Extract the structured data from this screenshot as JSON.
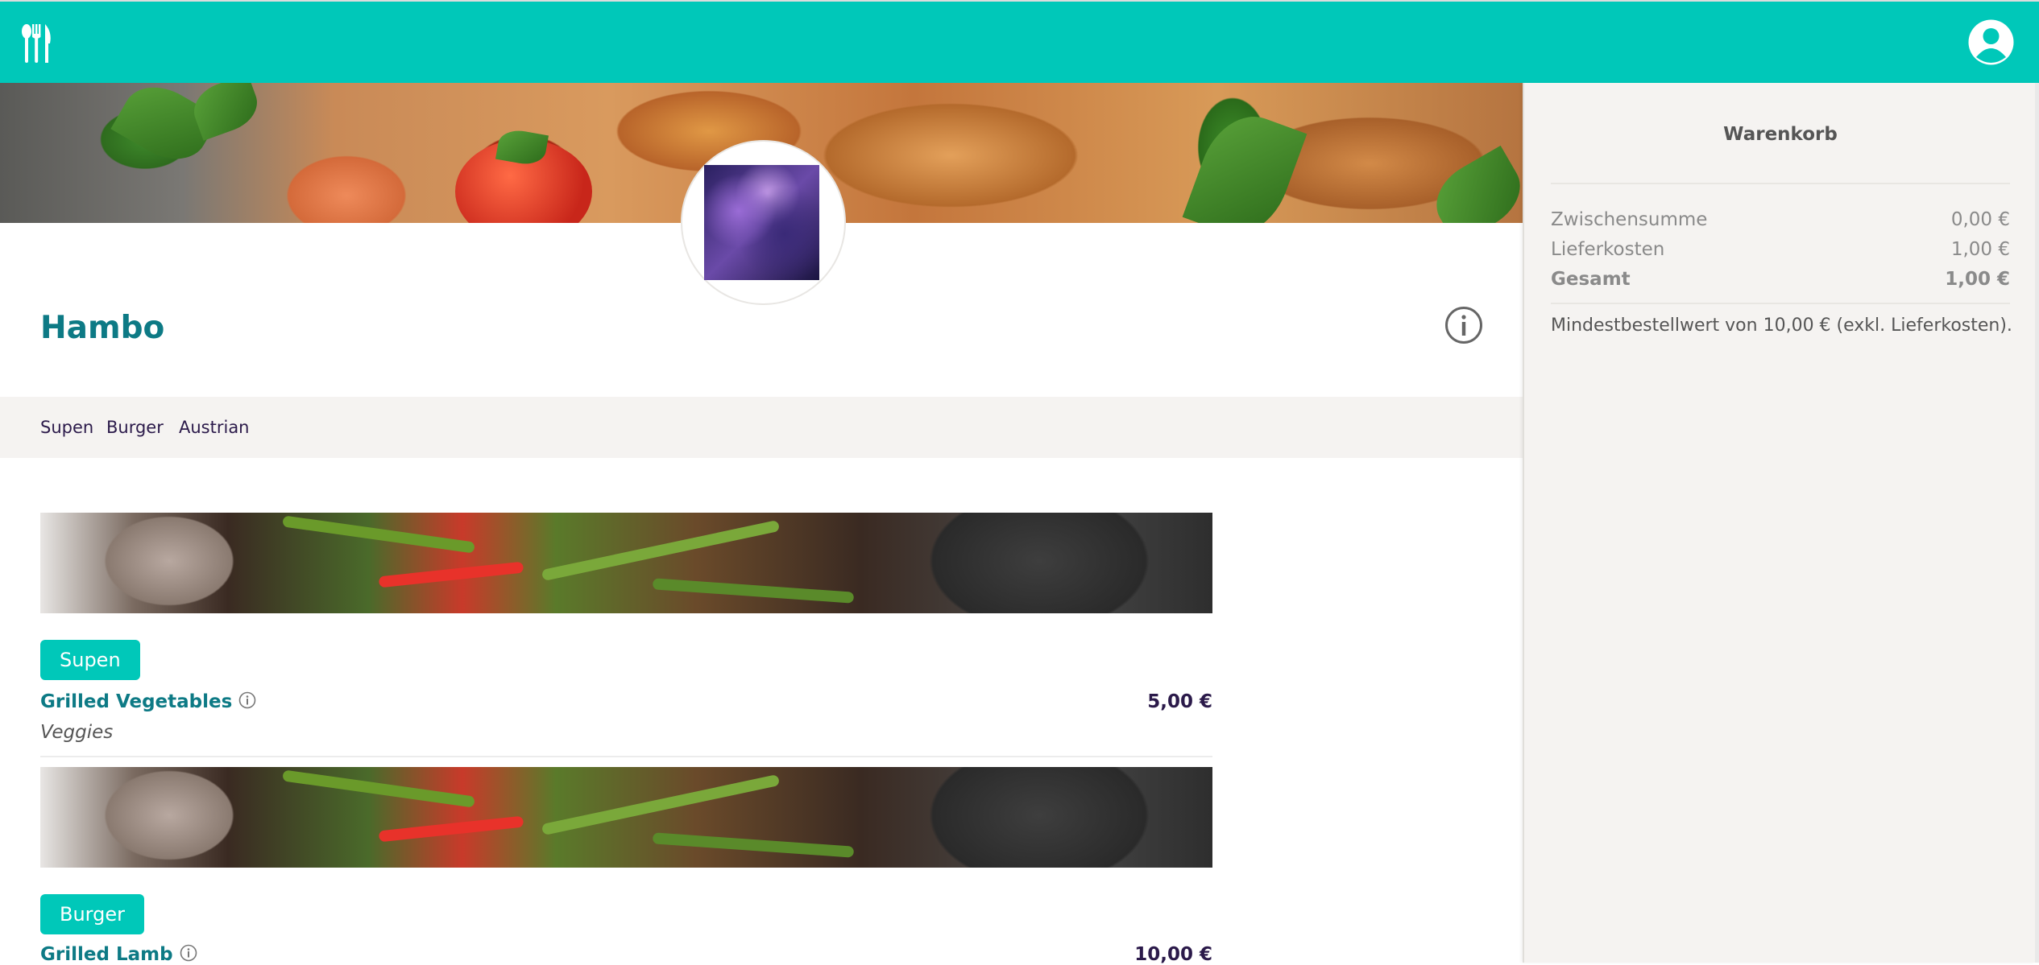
{
  "topbar": {
    "logo_icon": "cutlery-icon",
    "user_icon": "user-account-icon",
    "color": "#00c8b9"
  },
  "restaurant": {
    "name": "Hambo",
    "info_icon": "info-icon"
  },
  "categories": [
    "Supen",
    "Burger",
    "Austrian"
  ],
  "menu": [
    {
      "category": "Supen",
      "name": "Grilled Vegetables",
      "price": "5,00 €",
      "description": "Veggies"
    },
    {
      "category": "Burger",
      "name": "Grilled Lamb",
      "price": "10,00 €",
      "description": ""
    }
  ],
  "cart": {
    "title": "Warenkorb",
    "rows": [
      {
        "label": "Zwischensumme",
        "value": "0,00 €"
      },
      {
        "label": "Lieferkosten",
        "value": "1,00 €"
      },
      {
        "label": "Gesamt",
        "value": "1,00 €"
      }
    ],
    "min_order": "Mindestbestellwert von 10,00 € (exkl. Lieferkosten)."
  },
  "colors": {
    "accent": "#00c8b9",
    "title": "#0d7a85",
    "nav_text": "#2b1a4a"
  }
}
